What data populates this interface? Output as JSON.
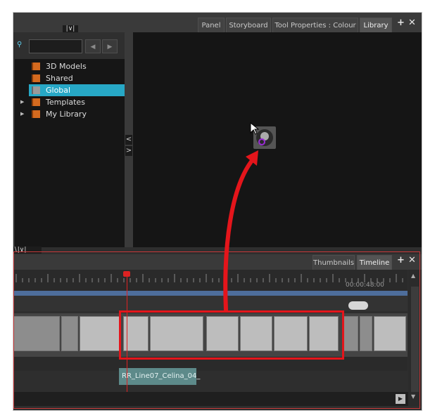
{
  "top_tabs": [
    {
      "label": "Panel",
      "active": false
    },
    {
      "label": "Storyboard",
      "active": false
    },
    {
      "label": "Tool Properties : Colour",
      "active": false
    },
    {
      "label": "Library",
      "active": true
    }
  ],
  "library": {
    "nav_back": "◀",
    "nav_forward": "▶",
    "tree": [
      {
        "label": "3D Models",
        "selected": false,
        "expandable": false
      },
      {
        "label": "Shared",
        "selected": false,
        "expandable": false
      },
      {
        "label": "Global",
        "selected": true,
        "expandable": false
      },
      {
        "label": "Templates",
        "selected": false,
        "expandable": true
      },
      {
        "label": "My Library",
        "selected": false,
        "expandable": true
      }
    ]
  },
  "timeline": {
    "tabs": [
      {
        "label": "Thumbnails",
        "active": false
      },
      {
        "label": "Timeline",
        "active": true
      }
    ],
    "time": "00:00:48:00",
    "clip_label": "RR_Line07_Celina_04_"
  },
  "colors": {
    "selection_highlight": "#27a8c6",
    "annotation": "#e4151b"
  }
}
